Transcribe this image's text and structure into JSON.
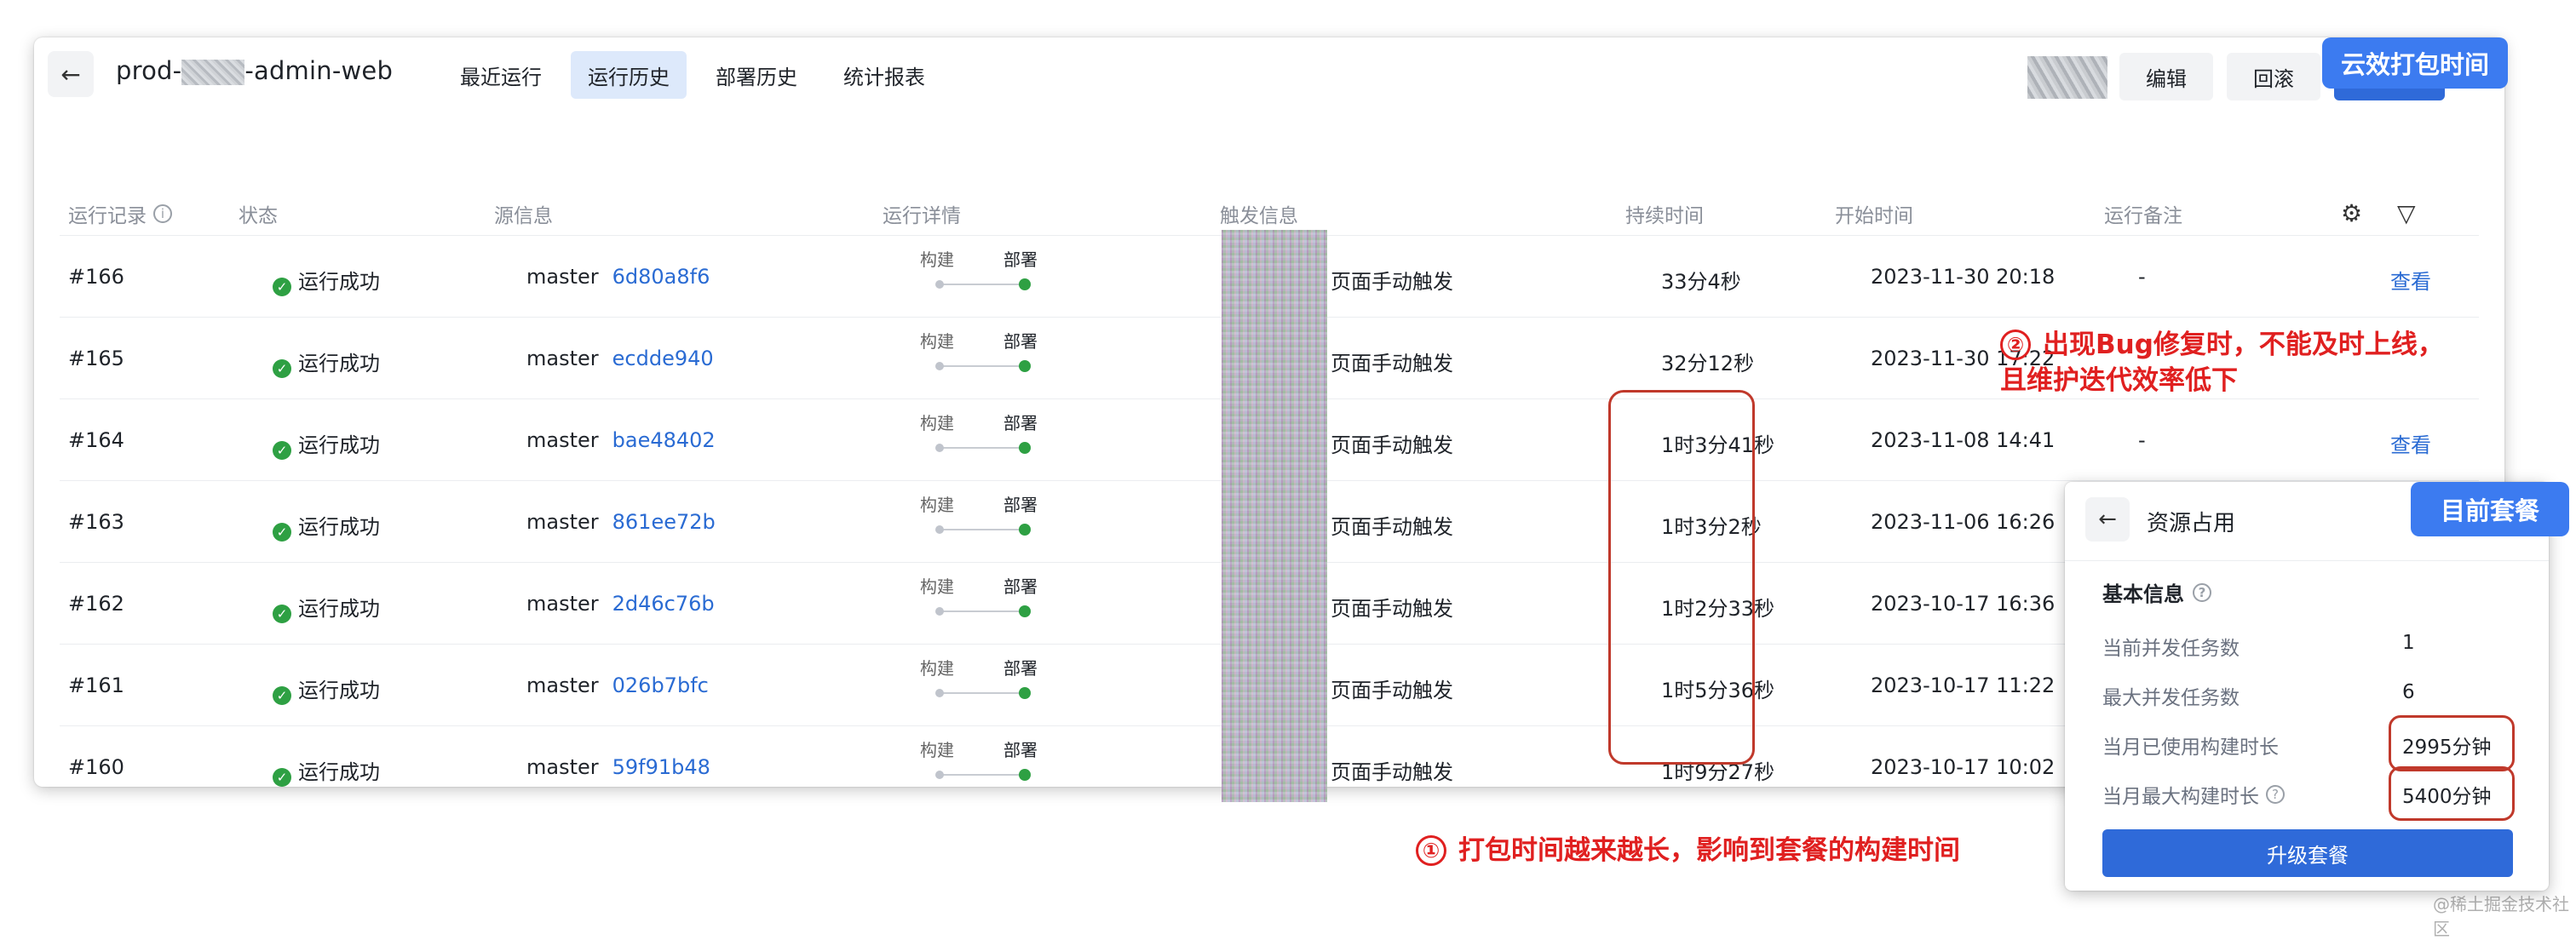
{
  "header": {
    "back_icon": "arrow-left-icon",
    "title_prefix": "prod-",
    "title_suffix": "-admin-web",
    "tabs": [
      {
        "label": "最近运行",
        "active": false
      },
      {
        "label": "运行历史",
        "active": true
      },
      {
        "label": "部署历史",
        "active": false
      },
      {
        "label": "统计报表",
        "active": false
      }
    ],
    "edit_label": "编辑",
    "rollback_label": "回滚",
    "callout_label": "云效打包时间"
  },
  "table": {
    "columns": {
      "run_record": "运行记录",
      "status": "状态",
      "source": "源信息",
      "run_detail": "运行详情",
      "trigger": "触发信息",
      "duration": "持续时间",
      "start_time": "开始时间",
      "remark": "运行备注"
    },
    "settings_icon": "gear-icon",
    "filter_icon": "filter-icon",
    "stage_build": "构建",
    "stage_deploy": "部署",
    "rows": [
      {
        "id": "#166",
        "status": "运行成功",
        "branch": "master",
        "commit": "6d80a8f6",
        "trigger": "页面手动触发",
        "duration": "33分4秒",
        "start": "2023-11-30 20:18",
        "remark": "-",
        "action": "查看"
      },
      {
        "id": "#165",
        "status": "运行成功",
        "branch": "master",
        "commit": "ecdde940",
        "trigger": "页面手动触发",
        "duration": "32分12秒",
        "start": "2023-11-30 17:22",
        "remark": "",
        "action": ""
      },
      {
        "id": "#164",
        "status": "运行成功",
        "branch": "master",
        "commit": "bae48402",
        "trigger": "页面手动触发",
        "duration": "1时3分41秒",
        "start": "2023-11-08 14:41",
        "remark": "-",
        "action": "查看"
      },
      {
        "id": "#163",
        "status": "运行成功",
        "branch": "master",
        "commit": "861ee72b",
        "trigger": "页面手动触发",
        "duration": "1时3分2秒",
        "start": "2023-11-06 16:26",
        "remark": "",
        "action": ""
      },
      {
        "id": "#162",
        "status": "运行成功",
        "branch": "master",
        "commit": "2d46c76b",
        "trigger": "页面手动触发",
        "duration": "1时2分33秒",
        "start": "2023-10-17 16:36",
        "remark": "",
        "action": ""
      },
      {
        "id": "#161",
        "status": "运行成功",
        "branch": "master",
        "commit": "026b7bfc",
        "trigger": "页面手动触发",
        "duration": "1时5分36秒",
        "start": "2023-10-17 11:22",
        "remark": "",
        "action": ""
      },
      {
        "id": "#160",
        "status": "运行成功",
        "branch": "master",
        "commit": "59f91b48",
        "trigger": "页面手动触发",
        "duration": "1时9分27秒",
        "start": "2023-10-17 10:02",
        "remark": "",
        "action": ""
      }
    ]
  },
  "annotations": {
    "note2_number": "②",
    "note2_line1": "出现Bug修复时，不能及时上线，",
    "note2_line2": "且维护迭代效率低下",
    "note1_number": "①",
    "note1_text": "打包时间越来越长，影响到套餐的构建时间",
    "plan_callout": "目前套餐",
    "accent_red": "#e02020",
    "accent_blue": "#3c7bf0"
  },
  "resource_panel": {
    "title": "资源占用",
    "section_title": "基本信息",
    "items": [
      {
        "label": "当前并发任务数",
        "value": "1"
      },
      {
        "label": "最大并发任务数",
        "value": "6"
      },
      {
        "label": "当月已使用构建时长",
        "value": "2995分钟"
      },
      {
        "label": "当月最大构建时长",
        "value": "5400分钟"
      }
    ],
    "upgrade_label": "升级套餐"
  },
  "watermark": "@稀土掘金技术社区"
}
